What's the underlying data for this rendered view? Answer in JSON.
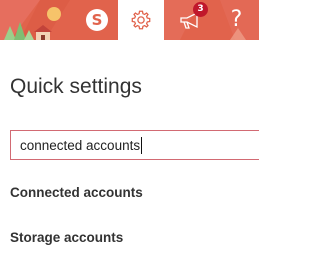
{
  "header": {
    "skype_icon": "skype-icon",
    "settings_icon": "gear-icon",
    "notifications_icon": "megaphone-icon",
    "notifications_count": "3",
    "help_icon": "help-icon",
    "help_glyph": "?",
    "skype_glyph": "S",
    "accent_color": "#e1634c",
    "badge_color": "#c0172b"
  },
  "panel": {
    "title": "Quick settings",
    "search_value": "connected accounts",
    "results": [
      {
        "label": "Connected accounts"
      },
      {
        "label": "Storage accounts"
      }
    ]
  }
}
